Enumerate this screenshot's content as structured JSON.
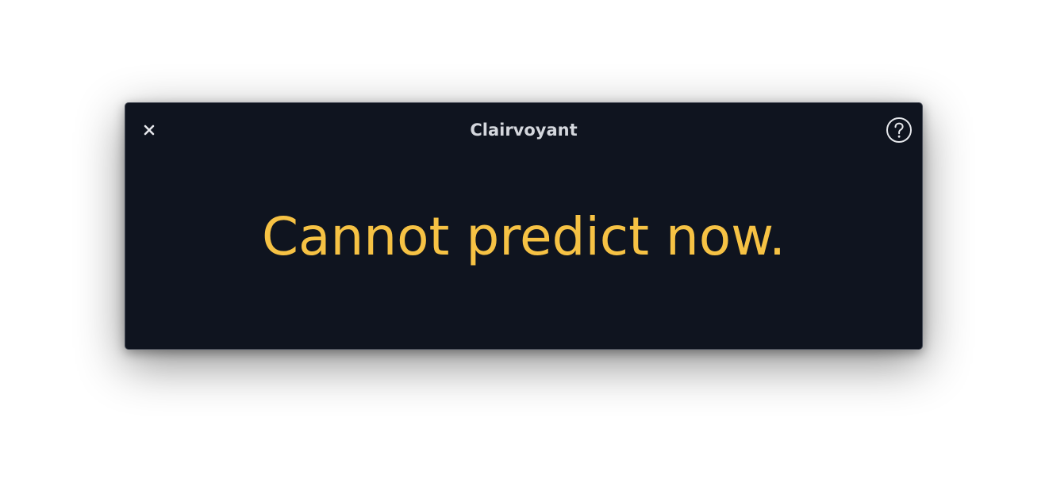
{
  "window": {
    "title": "Clairvoyant"
  },
  "titlebar": {
    "close_icon": "close-icon",
    "help_icon": "help-icon"
  },
  "main": {
    "prediction": "Cannot predict now."
  },
  "colors": {
    "window_bg": "#0f141f",
    "title_text": "#d4d7dd",
    "prediction_text": "#f6c244"
  }
}
